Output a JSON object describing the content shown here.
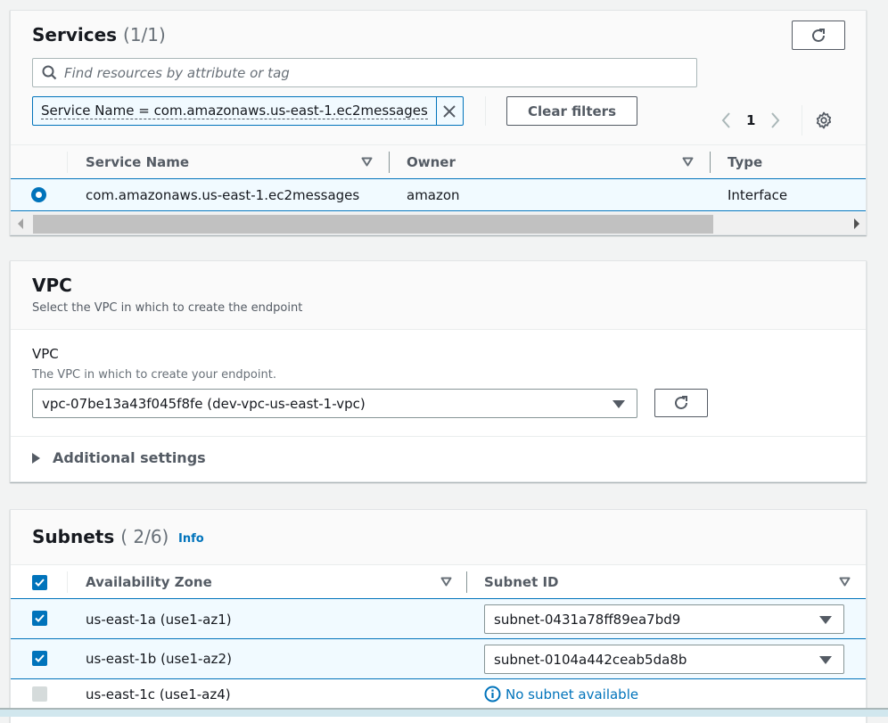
{
  "services": {
    "title": "Services",
    "count": "(1/1)",
    "search_placeholder": "Find resources by attribute or tag",
    "filter_token": "Service Name = com.amazonaws.us-east-1.ec2messages",
    "clear_filters_label": "Clear filters",
    "pagination": {
      "current_page": "1"
    },
    "columns": [
      "Service Name",
      "Owner",
      "Type"
    ],
    "rows": [
      {
        "service_name": "com.amazonaws.us-east-1.ec2messages",
        "owner": "amazon",
        "type": "Interface",
        "selected": true
      }
    ],
    "icons": {
      "search": "search-icon",
      "refresh": "refresh-icon",
      "close": "close-icon",
      "prev": "chevron-left-icon",
      "next": "chevron-right-icon",
      "settings": "gear-icon",
      "sort": "sort-triangle-icon"
    }
  },
  "vpc": {
    "title": "VPC",
    "description": "Select the VPC in which to create the endpoint",
    "field_label": "VPC",
    "field_description": "The VPC in which to create your endpoint.",
    "selected_vpc": "vpc-07be13a43f045f8fe (dev-vpc-us-east-1-vpc)",
    "additional_settings_label": "Additional settings"
  },
  "subnets": {
    "title": "Subnets",
    "count": "( 2/6)",
    "info_label": "Info",
    "columns": [
      "Availability Zone",
      "Subnet ID"
    ],
    "rows": [
      {
        "az": "us-east-1a (use1-az1)",
        "subnet_id": "subnet-0431a78ff89ea7bd9",
        "checked": true
      },
      {
        "az": "us-east-1b (use1-az2)",
        "subnet_id": "subnet-0104a442ceab5da8b",
        "checked": true
      },
      {
        "az": "us-east-1c (use1-az4)",
        "subnet_id": "",
        "status": "No subnet available",
        "checked": false,
        "disabled": true
      }
    ]
  },
  "colors": {
    "accent": "#0073bb",
    "selected_row_bg": "#f1faff",
    "text_primary": "#16191f",
    "text_secondary": "#545b64"
  }
}
